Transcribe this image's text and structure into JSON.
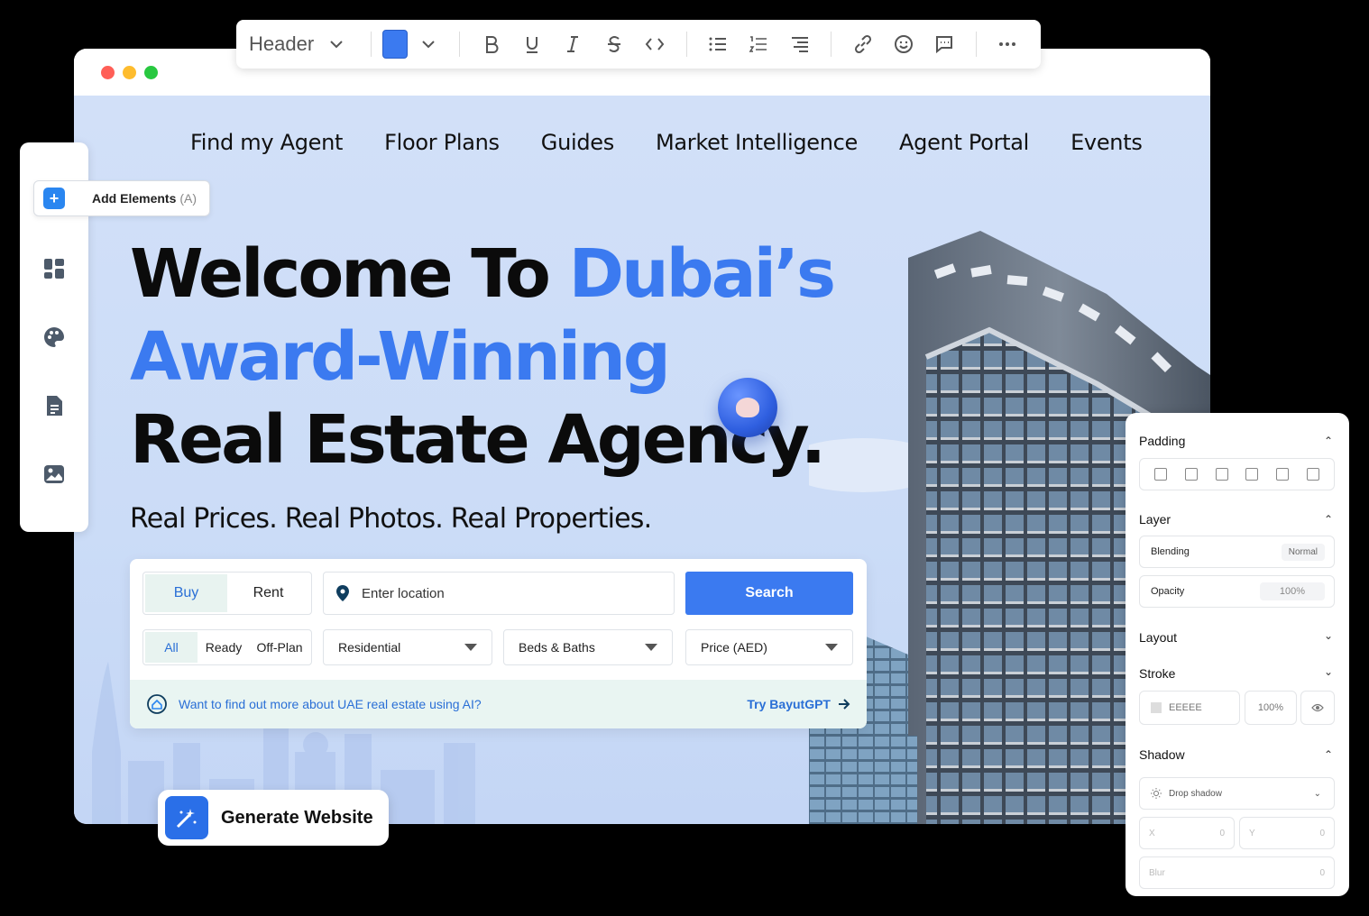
{
  "toolbar": {
    "block_type": "Header",
    "swatch_color": "#3B7AF0"
  },
  "sidebar": {
    "add_elements_label": "Add Elements",
    "add_elements_shortcut": "(A)"
  },
  "nav": {
    "items": [
      "Find my Agent",
      "Floor Plans",
      "Guides",
      "Market Intelligence",
      "Agent Portal",
      "Events"
    ]
  },
  "hero": {
    "line1_black": "Welcome To ",
    "line1_blue": "Dubai’s",
    "line2_blue": "Award-Winning",
    "line3_black": "Real Estate Agency.",
    "subline": "Real Prices. Real Photos. Real Properties."
  },
  "search": {
    "purpose_options": [
      "Buy",
      "Rent"
    ],
    "location_placeholder": "Enter location",
    "search_label": "Search",
    "status_options": [
      "All",
      "Ready",
      "Off-Plan"
    ],
    "property_type": "Residential",
    "beds_baths": "Beds & Baths",
    "price": "Price (AED)",
    "ai_prompt": "Want to find out more about UAE real estate using AI?",
    "ai_link": "Try BayutGPT"
  },
  "generate": {
    "label": "Generate Website"
  },
  "panel": {
    "padding_title": "Padding",
    "layer_title": "Layer",
    "blending_label": "Blending",
    "blending_value": "Normal",
    "opacity_label": "Opacity",
    "opacity_value": "100%",
    "layout_title": "Layout",
    "stroke_title": "Stroke",
    "stroke_color": "EEEEE",
    "stroke_opacity": "100%",
    "shadow_title": "Shadow",
    "shadow_type": "Drop shadow",
    "x_label": "X",
    "x_value": "0",
    "y_label": "Y",
    "y_value": "0",
    "blur_label": "Blur",
    "blur_value": "0"
  },
  "colors": {
    "accent": "#3B7AF0",
    "hero_bg": "#D2E0F8"
  }
}
